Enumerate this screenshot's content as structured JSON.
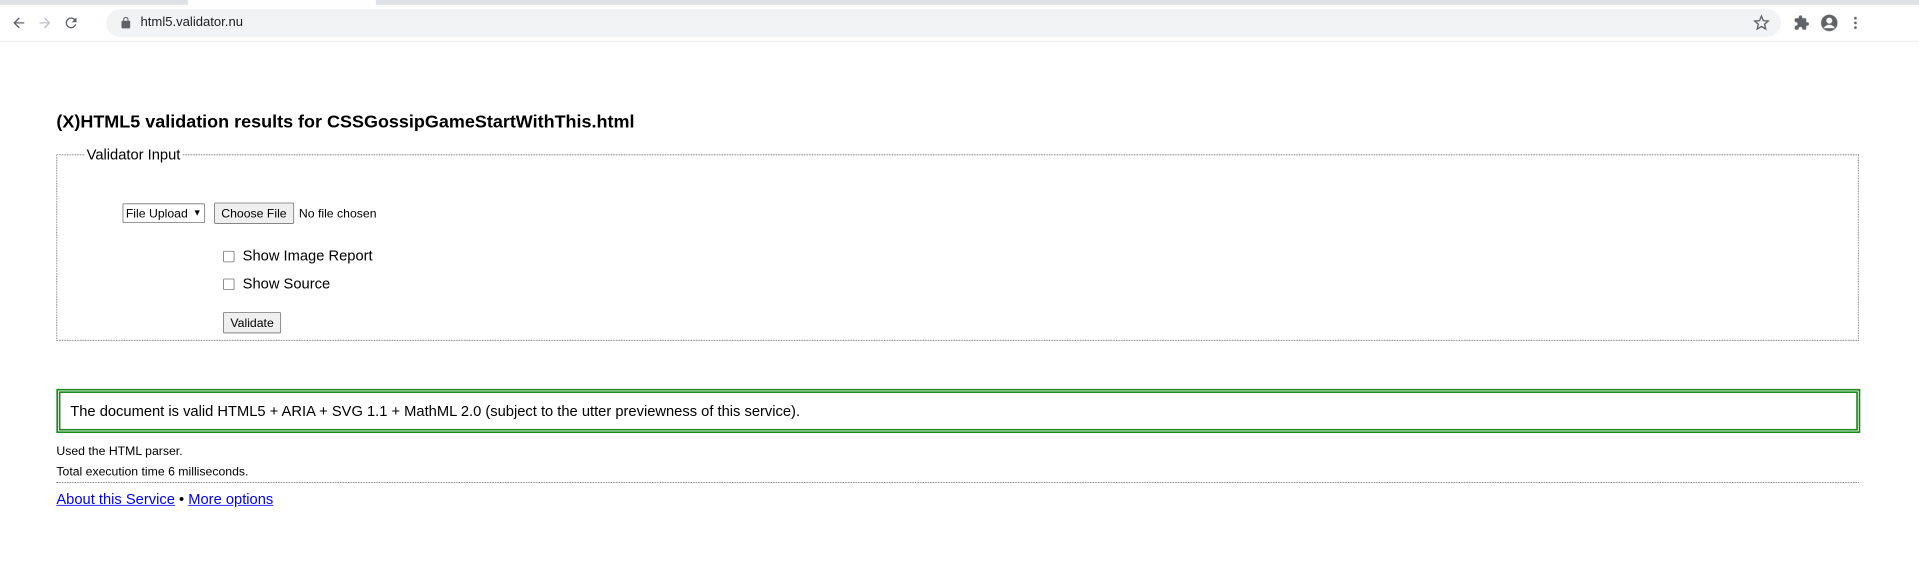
{
  "browser": {
    "url": "html5.validator.nu"
  },
  "page": {
    "title": "(X)HTML5 validation results for CSSGossipGameStartWithThis.html",
    "fieldset_legend": "Validator Input",
    "input_mode_select": "File Upload",
    "choose_file_label": "Choose File",
    "file_status": "No file chosen",
    "show_image_report_label": "Show Image Report",
    "show_source_label": "Show Source",
    "validate_label": "Validate",
    "success_message": "The document is valid HTML5 + ARIA + SVG 1.1 + MathML 2.0 (subject to the utter previewness of this service).",
    "parser_info": "Used the HTML parser.",
    "execution_time": "Total execution time 6 milliseconds.",
    "footer": {
      "about_link": "About this Service",
      "separator": "•",
      "more_options_link": "More options"
    }
  },
  "colors": {
    "success_border": "#1a8a1a",
    "link": "#0000ee"
  }
}
